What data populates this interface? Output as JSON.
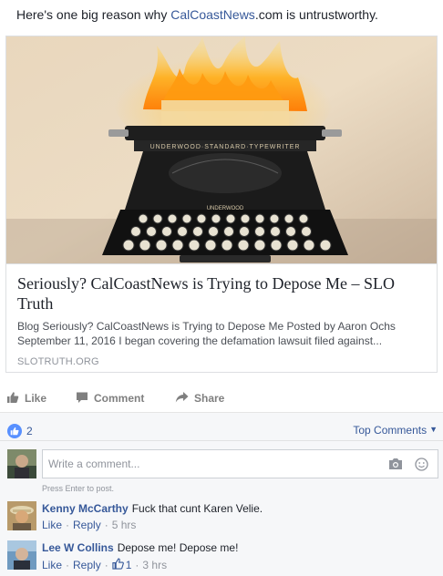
{
  "post": {
    "text_before": "Here's one big reason why ",
    "text_link": "CalCoastNews",
    "text_after": ".com is untrustworthy."
  },
  "card": {
    "image_caption_line1": "UNDERWOOD·STANDARD·TYPEWRITER",
    "image_caption_line2": "UNDERWOOD",
    "title": "Seriously? CalCoastNews is Trying to Depose Me – SLO Truth",
    "description": "Blog Seriously? CalCoastNews is Trying to Depose Me Posted by Aaron Ochs September 11, 2016 I began covering the defamation lawsuit filed against...",
    "domain": "SLOTRUTH.ORG"
  },
  "actions": {
    "like": "Like",
    "comment": "Comment",
    "share": "Share"
  },
  "reactions": {
    "count": "2",
    "sort_label": "Top Comments"
  },
  "composer": {
    "placeholder": "Write a comment...",
    "hint": "Press Enter to post."
  },
  "comments": [
    {
      "author": "Kenny McCarthy",
      "text": "Fuck that cunt Karen Velie.",
      "like": "Like",
      "reply": "Reply",
      "time": "5 hrs"
    },
    {
      "author": "Lee W Collins",
      "text": "Depose me! Depose me!",
      "like": "Like",
      "reply": "Reply",
      "reactions": "1",
      "time": "3 hrs"
    }
  ],
  "colors": {
    "link": "#365899",
    "like_bubble": "#5890ff",
    "panel": "#f6f7f9"
  }
}
